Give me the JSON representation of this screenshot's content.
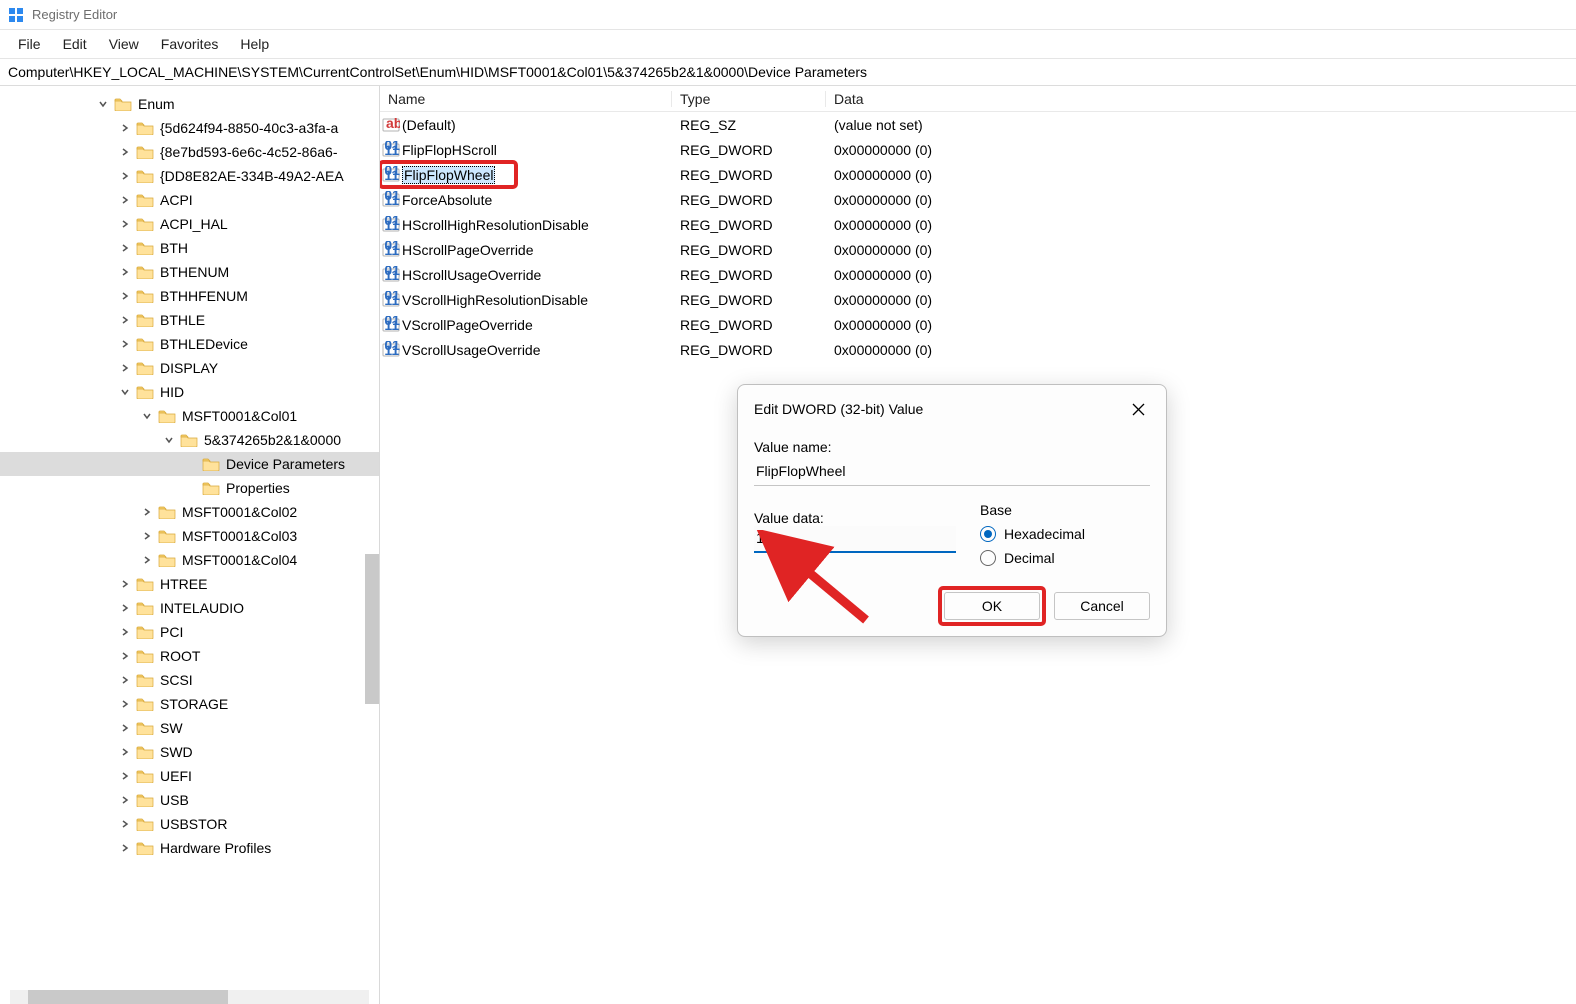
{
  "titlebar": {
    "title": "Registry Editor"
  },
  "menubar": {
    "items": [
      "File",
      "Edit",
      "View",
      "Favorites",
      "Help"
    ]
  },
  "addressbar": {
    "path": "Computer\\HKEY_LOCAL_MACHINE\\SYSTEM\\CurrentControlSet\\Enum\\HID\\MSFT0001&Col01\\5&374265b2&1&0000\\Device Parameters"
  },
  "tree": {
    "rows": [
      {
        "depth": 0,
        "exp": "v",
        "label": "Enum"
      },
      {
        "depth": 1,
        "exp": ">",
        "label": "{5d624f94-8850-40c3-a3fa-a"
      },
      {
        "depth": 1,
        "exp": ">",
        "label": "{8e7bd593-6e6c-4c52-86a6-"
      },
      {
        "depth": 1,
        "exp": ">",
        "label": "{DD8E82AE-334B-49A2-AEA"
      },
      {
        "depth": 1,
        "exp": ">",
        "label": "ACPI"
      },
      {
        "depth": 1,
        "exp": ">",
        "label": "ACPI_HAL"
      },
      {
        "depth": 1,
        "exp": ">",
        "label": "BTH"
      },
      {
        "depth": 1,
        "exp": ">",
        "label": "BTHENUM"
      },
      {
        "depth": 1,
        "exp": ">",
        "label": "BTHHFENUM"
      },
      {
        "depth": 1,
        "exp": ">",
        "label": "BTHLE"
      },
      {
        "depth": 1,
        "exp": ">",
        "label": "BTHLEDevice"
      },
      {
        "depth": 1,
        "exp": ">",
        "label": "DISPLAY"
      },
      {
        "depth": 1,
        "exp": "v",
        "label": "HID"
      },
      {
        "depth": 2,
        "exp": "v",
        "label": "MSFT0001&Col01"
      },
      {
        "depth": 3,
        "exp": "v",
        "label": "5&374265b2&1&0000"
      },
      {
        "depth": 4,
        "exp": "",
        "label": "Device Parameters",
        "selected": true
      },
      {
        "depth": 4,
        "exp": "",
        "label": "Properties"
      },
      {
        "depth": 2,
        "exp": ">",
        "label": "MSFT0001&Col02"
      },
      {
        "depth": 2,
        "exp": ">",
        "label": "MSFT0001&Col03"
      },
      {
        "depth": 2,
        "exp": ">",
        "label": "MSFT0001&Col04"
      },
      {
        "depth": 1,
        "exp": ">",
        "label": "HTREE"
      },
      {
        "depth": 1,
        "exp": ">",
        "label": "INTELAUDIO"
      },
      {
        "depth": 1,
        "exp": ">",
        "label": "PCI"
      },
      {
        "depth": 1,
        "exp": ">",
        "label": "ROOT"
      },
      {
        "depth": 1,
        "exp": ">",
        "label": "SCSI"
      },
      {
        "depth": 1,
        "exp": ">",
        "label": "STORAGE"
      },
      {
        "depth": 1,
        "exp": ">",
        "label": "SW"
      },
      {
        "depth": 1,
        "exp": ">",
        "label": "SWD"
      },
      {
        "depth": 1,
        "exp": ">",
        "label": "UEFI"
      },
      {
        "depth": 1,
        "exp": ">",
        "label": "USB"
      },
      {
        "depth": 1,
        "exp": ">",
        "label": "USBSTOR"
      },
      {
        "depth": 1,
        "exp": ">",
        "label": "Hardware Profiles"
      }
    ]
  },
  "values": {
    "header": {
      "name": "Name",
      "type": "Type",
      "data": "Data"
    },
    "rows": [
      {
        "icon": "sz",
        "name": "(Default)",
        "type": "REG_SZ",
        "data": "(value not set)"
      },
      {
        "icon": "dw",
        "name": "FlipFlopHScroll",
        "type": "REG_DWORD",
        "data": "0x00000000 (0)"
      },
      {
        "icon": "dw",
        "name": "FlipFlopWheel",
        "type": "REG_DWORD",
        "data": "0x00000000 (0)",
        "sel": true
      },
      {
        "icon": "dw",
        "name": "ForceAbsolute",
        "type": "REG_DWORD",
        "data": "0x00000000 (0)"
      },
      {
        "icon": "dw",
        "name": "HScrollHighResolutionDisable",
        "type": "REG_DWORD",
        "data": "0x00000000 (0)"
      },
      {
        "icon": "dw",
        "name": "HScrollPageOverride",
        "type": "REG_DWORD",
        "data": "0x00000000 (0)"
      },
      {
        "icon": "dw",
        "name": "HScrollUsageOverride",
        "type": "REG_DWORD",
        "data": "0x00000000 (0)"
      },
      {
        "icon": "dw",
        "name": "VScrollHighResolutionDisable",
        "type": "REG_DWORD",
        "data": "0x00000000 (0)"
      },
      {
        "icon": "dw",
        "name": "VScrollPageOverride",
        "type": "REG_DWORD",
        "data": "0x00000000 (0)"
      },
      {
        "icon": "dw",
        "name": "VScrollUsageOverride",
        "type": "REG_DWORD",
        "data": "0x00000000 (0)"
      }
    ]
  },
  "dialog": {
    "title": "Edit DWORD (32-bit) Value",
    "value_name_label": "Value name:",
    "value_name": "FlipFlopWheel",
    "value_data_label": "Value data:",
    "value_data": "1",
    "base_label": "Base",
    "hex_label": "Hexadecimal",
    "dec_label": "Decimal",
    "ok": "OK",
    "cancel": "Cancel"
  }
}
